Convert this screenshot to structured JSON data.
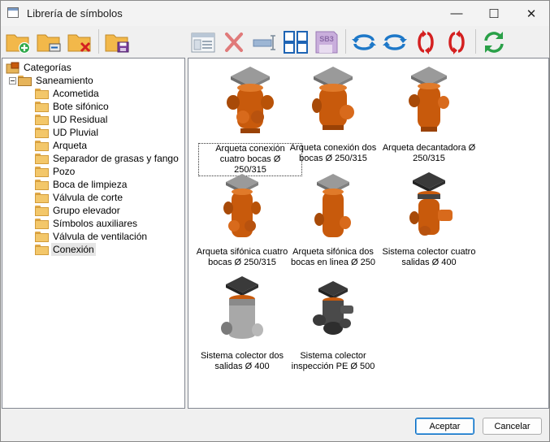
{
  "window": {
    "title": "Librería de símbolos",
    "minimize_glyph": "—",
    "maximize_glyph": "☐",
    "close_glyph": "✕"
  },
  "toolbar": {
    "buttons": [
      {
        "name": "new-category-button",
        "icon": "folder-add-icon"
      },
      {
        "name": "edit-category-button",
        "icon": "folder-edit-icon"
      },
      {
        "name": "delete-category-button",
        "icon": "folder-delete-icon"
      },
      {
        "name": "save-library-button",
        "icon": "folder-save-icon"
      },
      {
        "name": "symbol-properties-button",
        "icon": "window-properties-icon"
      },
      {
        "name": "delete-symbol-button",
        "icon": "red-x-icon"
      },
      {
        "name": "rename-symbol-button",
        "icon": "rename-field-icon"
      },
      {
        "name": "view-grid-button",
        "icon": "grid-view-icon"
      },
      {
        "name": "save-sb3-button",
        "icon": "sb3-save-icon",
        "text": "SB3"
      },
      {
        "name": "rotate-left-button",
        "icon": "rotate-horizontal-left-icon"
      },
      {
        "name": "rotate-right-button",
        "icon": "rotate-horizontal-right-icon"
      },
      {
        "name": "rotate-vertical-up-button",
        "icon": "rotate-vertical-up-icon"
      },
      {
        "name": "rotate-vertical-down-button",
        "icon": "rotate-vertical-down-icon"
      },
      {
        "name": "refresh-button",
        "icon": "refresh-icon"
      }
    ]
  },
  "tree": {
    "root": "Categorías",
    "group": "Saneamiento",
    "items": [
      "Acometida",
      "Bote sifónico",
      "UD Residual",
      "UD Pluvial",
      "Arqueta",
      "Separador de grasas y fango",
      "Pozo",
      "Boca de limpieza",
      "Válvula de corte",
      "Grupo elevador",
      "Símbolos auxiliares",
      "Válvula de ventilación",
      "Conexión"
    ],
    "selected": "Conexión"
  },
  "gallery": {
    "items": [
      {
        "line1": "Arqueta conexión",
        "line2": "cuatro bocas Ø",
        "line3": "250/315"
      },
      {
        "line1": "Arqueta conexión dos",
        "line2": "bocas Ø 250/315",
        "line3": ""
      },
      {
        "line1": "Arqueta decantadora Ø",
        "line2": "250/315",
        "line3": ""
      },
      {
        "line1": "Arqueta sifónica cuatro",
        "line2": "bocas Ø 250/315",
        "line3": ""
      },
      {
        "line1": "Arqueta sifónica dos",
        "line2": "bocas en linea Ø 250",
        "line3": ""
      },
      {
        "line1": "Sistema colector cuatro",
        "line2": "salidas Ø 400",
        "line3": ""
      },
      {
        "line1": "Sistema colector dos",
        "line2": "salidas Ø 400",
        "line3": ""
      },
      {
        "line1": "Sistema colector",
        "line2": "inspección PE Ø 500",
        "line3": ""
      }
    ]
  },
  "footer": {
    "accept_label": "Aceptar",
    "cancel_label": "Cancelar"
  },
  "colors": {
    "orange_pipe": "#c85a0c",
    "lid_gray": "#8a8a8a",
    "accent_blue": "#1e78c8",
    "accent_red": "#d42020",
    "accent_green": "#2aa048"
  }
}
